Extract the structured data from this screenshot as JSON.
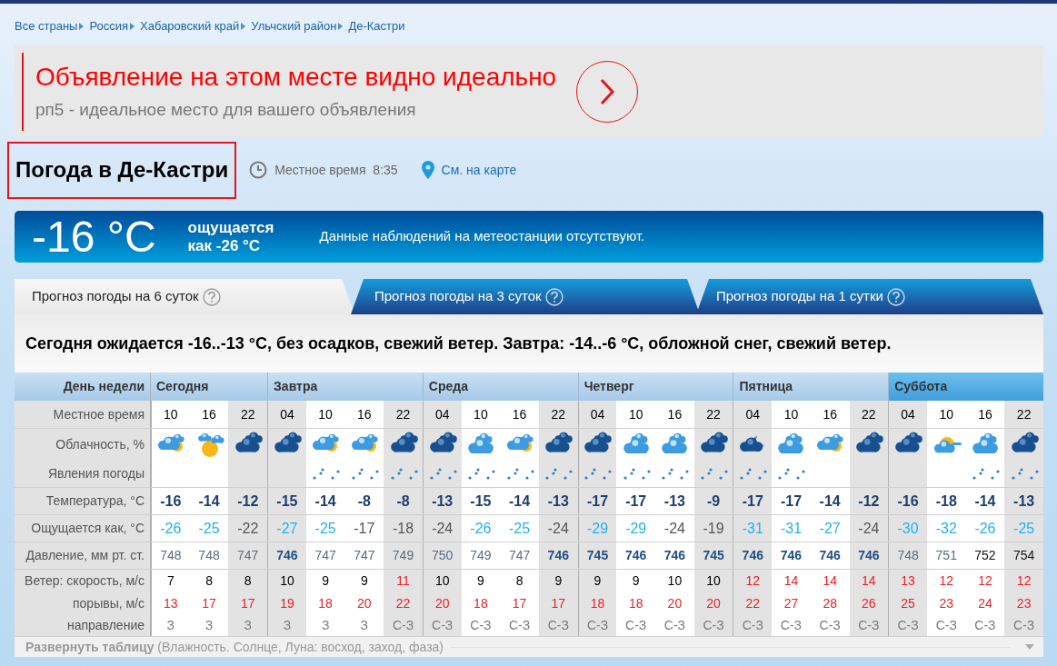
{
  "breadcrumbs": [
    "Все страны",
    "Россия",
    "Хабаровский край",
    "Ульчский район",
    "Де-Кастри"
  ],
  "ad": {
    "title": "Объявление на этом месте видно идеально",
    "subtitle": "рп5 - идеальное место для вашего объявления"
  },
  "header": {
    "title": "Погода в Де-Кастри",
    "local_time_label": "Местное время",
    "local_time": "8:35",
    "map_link": "См. на карте"
  },
  "current": {
    "temperature": "-16 °C",
    "feels_line1": "ощущается",
    "feels_line2": "как -26 °C",
    "message": "Данные наблюдений на метеостанции отсутствуют."
  },
  "tabs": [
    {
      "label": "Прогноз погоды на 6 суток",
      "selected": true
    },
    {
      "label": "Прогноз погоды на 3 суток",
      "selected": false
    },
    {
      "label": "Прогноз погоды на 1 сутки",
      "selected": false
    }
  ],
  "summary": "Сегодня ожидается -16..-13 °C, без осадков, свежий ветер. Завтра: -14..-6 °C, обложной снег, свежий ветер.",
  "table": {
    "row_labels": [
      "День недели",
      "Местное время",
      "Облачность, %",
      "Явления погоды",
      "Температура, °C",
      "Ощущается как, °C",
      "Давление, мм рт. ст.",
      "Ветер: скорость, м/с",
      "порывы, м/с",
      "направление"
    ],
    "days": [
      {
        "name": "Сегодня",
        "selected": false,
        "slots": [
          {
            "time": "10",
            "night": false,
            "kind": "partly",
            "snow": false,
            "temp": "-16",
            "feels": "-26",
            "cold": true,
            "pressure": "748",
            "bold": false,
            "muted": true,
            "wind": "7",
            "strong": false,
            "gust": "13",
            "dir": "З"
          },
          {
            "time": "16",
            "night": false,
            "kind": "sun",
            "snow": false,
            "temp": "-14",
            "feels": "-25",
            "cold": true,
            "pressure": "748",
            "bold": false,
            "muted": true,
            "wind": "8",
            "strong": false,
            "gust": "17",
            "dir": "З"
          },
          {
            "time": "22",
            "night": true,
            "kind": "overcast",
            "snow": false,
            "temp": "-12",
            "feels": "-22",
            "cold": false,
            "pressure": "747",
            "bold": false,
            "muted": true,
            "wind": "8",
            "strong": false,
            "gust": "17",
            "dir": "З"
          }
        ]
      },
      {
        "name": "Завтра",
        "selected": false,
        "slots": [
          {
            "time": "04",
            "night": true,
            "kind": "overcast",
            "snow": false,
            "temp": "-15",
            "feels": "-27",
            "cold": true,
            "pressure": "746",
            "bold": true,
            "muted": false,
            "wind": "10",
            "strong": false,
            "gust": "19",
            "dir": "З"
          },
          {
            "time": "10",
            "night": false,
            "kind": "partly",
            "snow": true,
            "temp": "-14",
            "feels": "-25",
            "cold": true,
            "pressure": "747",
            "bold": false,
            "muted": true,
            "wind": "9",
            "strong": false,
            "gust": "18",
            "dir": "З"
          },
          {
            "time": "16",
            "night": false,
            "kind": "partly",
            "snow": true,
            "temp": "-8",
            "feels": "-17",
            "cold": false,
            "pressure": "747",
            "bold": false,
            "muted": true,
            "wind": "9",
            "strong": false,
            "gust": "20",
            "dir": "З"
          },
          {
            "time": "22",
            "night": true,
            "kind": "overcast",
            "snow": true,
            "temp": "-8",
            "feels": "-18",
            "cold": false,
            "pressure": "749",
            "bold": false,
            "muted": true,
            "wind": "11",
            "strong": true,
            "gust": "22",
            "dir": "С-З"
          }
        ]
      },
      {
        "name": "Среда",
        "selected": false,
        "slots": [
          {
            "time": "04",
            "night": true,
            "kind": "overcast",
            "snow": true,
            "temp": "-13",
            "feels": "-24",
            "cold": false,
            "pressure": "750",
            "bold": false,
            "muted": true,
            "wind": "10",
            "strong": false,
            "gust": "20",
            "dir": "С-З"
          },
          {
            "time": "10",
            "night": false,
            "kind": "cloudy",
            "snow": true,
            "temp": "-15",
            "feels": "-26",
            "cold": true,
            "pressure": "749",
            "bold": false,
            "muted": true,
            "wind": "9",
            "strong": false,
            "gust": "18",
            "dir": "С-З"
          },
          {
            "time": "16",
            "night": false,
            "kind": "partly",
            "snow": true,
            "temp": "-14",
            "feels": "-25",
            "cold": true,
            "pressure": "747",
            "bold": false,
            "muted": true,
            "wind": "8",
            "strong": false,
            "gust": "17",
            "dir": "С-З"
          },
          {
            "time": "22",
            "night": true,
            "kind": "overcast",
            "snow": true,
            "temp": "-13",
            "feels": "-24",
            "cold": false,
            "pressure": "746",
            "bold": true,
            "muted": false,
            "wind": "9",
            "strong": false,
            "gust": "17",
            "dir": "С-З"
          }
        ]
      },
      {
        "name": "Четверг",
        "selected": false,
        "slots": [
          {
            "time": "04",
            "night": true,
            "kind": "overcast",
            "snow": true,
            "temp": "-17",
            "feels": "-29",
            "cold": true,
            "pressure": "745",
            "bold": true,
            "muted": false,
            "wind": "9",
            "strong": false,
            "gust": "18",
            "dir": "С-З"
          },
          {
            "time": "10",
            "night": false,
            "kind": "cloudy",
            "snow": true,
            "temp": "-17",
            "feels": "-29",
            "cold": true,
            "pressure": "746",
            "bold": true,
            "muted": false,
            "wind": "9",
            "strong": false,
            "gust": "18",
            "dir": "С-З"
          },
          {
            "time": "16",
            "night": false,
            "kind": "cloudy",
            "snow": true,
            "temp": "-13",
            "feels": "-24",
            "cold": false,
            "pressure": "746",
            "bold": true,
            "muted": false,
            "wind": "10",
            "strong": false,
            "gust": "20",
            "dir": "С-З"
          },
          {
            "time": "22",
            "night": true,
            "kind": "overcast",
            "snow": true,
            "temp": "-9",
            "feels": "-19",
            "cold": false,
            "pressure": "745",
            "bold": true,
            "muted": false,
            "wind": "10",
            "strong": false,
            "gust": "20",
            "dir": "С-З"
          }
        ]
      },
      {
        "name": "Пятница",
        "selected": false,
        "slots": [
          {
            "time": "04",
            "night": true,
            "kind": "night",
            "snow": true,
            "temp": "-17",
            "feels": "-31",
            "cold": true,
            "pressure": "746",
            "bold": true,
            "muted": false,
            "wind": "12",
            "strong": true,
            "gust": "22",
            "dir": "С-З"
          },
          {
            "time": "10",
            "night": false,
            "kind": "cloudy",
            "snow": true,
            "temp": "-17",
            "feels": "-31",
            "cold": true,
            "pressure": "746",
            "bold": true,
            "muted": false,
            "wind": "14",
            "strong": true,
            "gust": "27",
            "dir": "С-З"
          },
          {
            "time": "16",
            "night": false,
            "kind": "partly",
            "snow": false,
            "temp": "-14",
            "feels": "-27",
            "cold": true,
            "pressure": "746",
            "bold": true,
            "muted": false,
            "wind": "14",
            "strong": true,
            "gust": "28",
            "dir": "С-З"
          },
          {
            "time": "22",
            "night": true,
            "kind": "overcast",
            "snow": false,
            "temp": "-12",
            "feels": "-24",
            "cold": false,
            "pressure": "746",
            "bold": true,
            "muted": false,
            "wind": "14",
            "strong": true,
            "gust": "26",
            "dir": "С-З"
          }
        ]
      },
      {
        "name": "Суббота",
        "selected": true,
        "slots": [
          {
            "time": "04",
            "night": true,
            "kind": "overcast",
            "snow": false,
            "temp": "-16",
            "feels": "-30",
            "cold": true,
            "pressure": "748",
            "bold": false,
            "muted": true,
            "wind": "13",
            "strong": true,
            "gust": "25",
            "dir": "С-З"
          },
          {
            "time": "10",
            "night": false,
            "kind": "sun_cloud",
            "snow": false,
            "temp": "-18",
            "feels": "-32",
            "cold": true,
            "pressure": "751",
            "bold": false,
            "muted": true,
            "wind": "12",
            "strong": true,
            "gust": "23",
            "dir": "С-З"
          },
          {
            "time": "16",
            "night": false,
            "kind": "cloudy",
            "snow": true,
            "temp": "-14",
            "feels": "-26",
            "cold": true,
            "pressure": "752",
            "bold": false,
            "muted": false,
            "wind": "12",
            "strong": true,
            "gust": "24",
            "dir": "С-З"
          },
          {
            "time": "22",
            "night": true,
            "kind": "overcast",
            "snow": true,
            "temp": "-13",
            "feels": "-25",
            "cold": true,
            "pressure": "754",
            "bold": false,
            "muted": false,
            "wind": "12",
            "strong": true,
            "gust": "23",
            "dir": "С-З"
          }
        ]
      }
    ]
  },
  "expand": "**Развернуть таблицу** (Влажность. Солнце, Луна: восход, заход, фаза)"
}
